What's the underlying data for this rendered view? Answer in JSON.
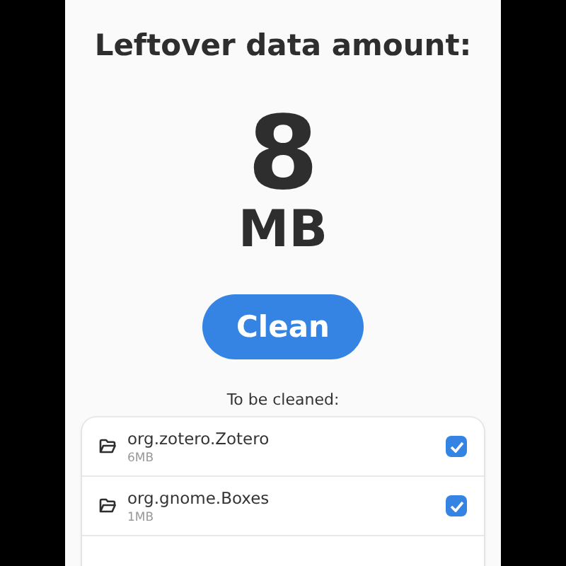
{
  "heading": "Leftover data amount:",
  "amount": {
    "value": "8",
    "unit": "MB"
  },
  "clean_button": "Clean",
  "list_title": "To be cleaned:",
  "items": [
    {
      "name": "org.zotero.Zotero",
      "size": "6MB",
      "checked": true
    },
    {
      "name": "org.gnome.Boxes",
      "size": "1MB",
      "checked": true
    }
  ]
}
